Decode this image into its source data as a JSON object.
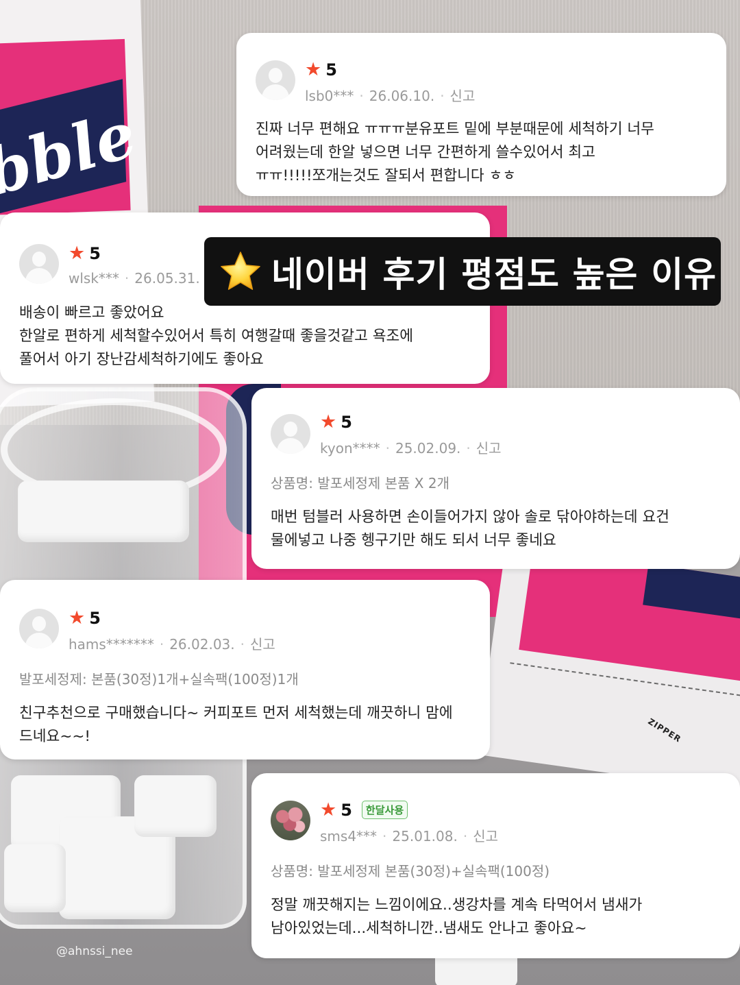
{
  "headline": {
    "text": "네이버 후기 평점도 높은 이유",
    "icon": "star-emoji-icon"
  },
  "reviews": [
    {
      "rating": "5",
      "user": "lsb0***",
      "date": "26.06.10.",
      "report": "신고",
      "text": "진짜 너무 편해요 ㅠㅠㅠ분유포트 밑에 부분때문에 세척하기 너무\n어려웠는데 한알 넣으면 너무 간편하게 쓸수있어서 최고\nㅠㅠ!!!!!쪼개는것도 잘되서 편합니다 ㅎㅎ"
    },
    {
      "rating": "5",
      "user": "wlsk***",
      "date": "26.05.31.",
      "text": "배송이 빠르고 좋았어요\n한알로 편하게 세척할수있어서 특히 여행갈때 좋을것같고 욕조에\n풀어서 아기 장난감세척하기에도 좋아요"
    },
    {
      "rating": "5",
      "user": "kyon****",
      "date": "25.02.09.",
      "report": "신고",
      "product": "상품명: 발포세정제 본품 X 2개",
      "text": "매번 텀블러 사용하면 손이들어가지 않아 솔로 닦아야하는데 요건\n물에넣고 나중 헹구기만 해도 되서 너무 좋네요"
    },
    {
      "rating": "5",
      "user": "hams*******",
      "date": "26.02.03.",
      "report": "신고",
      "product": "발포세정제: 본품(30정)1개+실속팩(100정)1개",
      "text": "친구추천으로 구매했습니다~ 커피포트 먼저 세척했는데 깨끗하니 맘에\n드네요~~!"
    },
    {
      "rating": "5",
      "badge": "한달사용",
      "user": "sms4***",
      "date": "25.01.08.",
      "report": "신고",
      "product": "상품명: 발포세정제 본품(30정)+실속팩(100정)",
      "text": "정말 깨끗해지는 느낌이에요..생강차를 계속 타먹어서 냄새가\n남아있었는데...세척하니깐..냄새도 안나고 좋아요~"
    }
  ],
  "background": {
    "bag_brand": "bble",
    "bag_right_brand": "ble",
    "zipper_label": "ZIPPER"
  },
  "watermark": "@ahnssi_nee",
  "colors": {
    "star": "#f24a2d",
    "banner_bg": "#111111",
    "brand_pink": "#e5307a",
    "brand_navy": "#1d2556",
    "badge_green": "#3a9a3a"
  }
}
